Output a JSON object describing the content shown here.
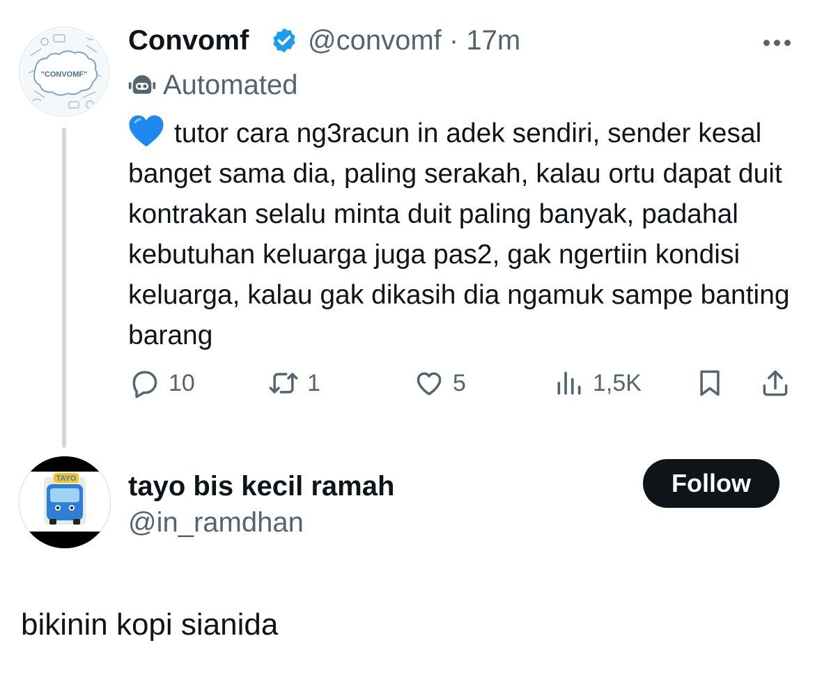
{
  "tweet": {
    "author_name": "Convomf",
    "author_handle": "@convomf",
    "separator": "·",
    "time": "17m",
    "automated_label": "Automated",
    "avatar_text": "\"CONVOMF\"",
    "text": "tutor cara ng3racun in adek sendiri, sender kesal banget sama dia, paling serakah, kalau ortu dapat duit kontrakan selalu minta duit paling banyak, padahal kebutuhan keluarga juga pas2, gak ngertiin kondisi keluarga, kalau gak dikasih dia ngamuk sampe banting barang",
    "emoji": "blue-heart-emoji",
    "stats": {
      "replies": "10",
      "retweets": "1",
      "likes": "5",
      "views": "1,5K"
    }
  },
  "reply_user": {
    "name": "tayo bis kecil ramah",
    "handle": "@in_ramdhan",
    "avatar_logo_text": "TAYO",
    "follow_label": "Follow"
  },
  "reply_text": "bikinin kopi sianida",
  "colors": {
    "text_primary": "#0f1419",
    "text_secondary": "#536471",
    "verified_blue": "#1d9bf0",
    "thread_line": "#cfd9de",
    "button_bg": "#0f1419"
  }
}
